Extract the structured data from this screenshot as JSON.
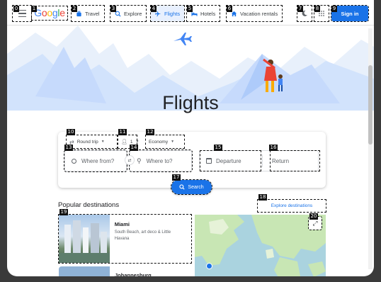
{
  "header": {
    "logo_text": "Google",
    "nav": [
      {
        "label": "Travel",
        "icon": "suitcase-icon"
      },
      {
        "label": "Explore",
        "icon": "explore-icon"
      },
      {
        "label": "Flights",
        "icon": "airplane-icon",
        "active": true
      },
      {
        "label": "Hotels",
        "icon": "bed-icon"
      },
      {
        "label": "Vacation rentals",
        "icon": "house-icon"
      }
    ],
    "sign_in": "Sign in"
  },
  "hero": {
    "title": "Flights"
  },
  "search": {
    "trip_type": "Round trip",
    "passengers": "1",
    "cabin_class": "Economy",
    "from_placeholder": "Where from?",
    "to_placeholder": "Where to?",
    "departure_placeholder": "Departure",
    "return_placeholder": "Return",
    "search_label": "Search"
  },
  "popular": {
    "title": "Popular destinations",
    "explore_label": "Explore destinations",
    "destinations": [
      {
        "name": "Miami",
        "description": "South Beach, art deco & Little Havana"
      },
      {
        "name": "Johannesburg",
        "description": ""
      }
    ]
  },
  "annotations": [
    "0",
    "1",
    "2",
    "3",
    "4",
    "5",
    "6",
    "7",
    "8",
    "9",
    "10",
    "11",
    "12",
    "13",
    "14",
    "15",
    "16",
    "17",
    "18",
    "19",
    "20"
  ],
  "colors": {
    "accent": "#1a73e8",
    "map_water": "#aad3df",
    "map_land": "#c8e6b4"
  }
}
